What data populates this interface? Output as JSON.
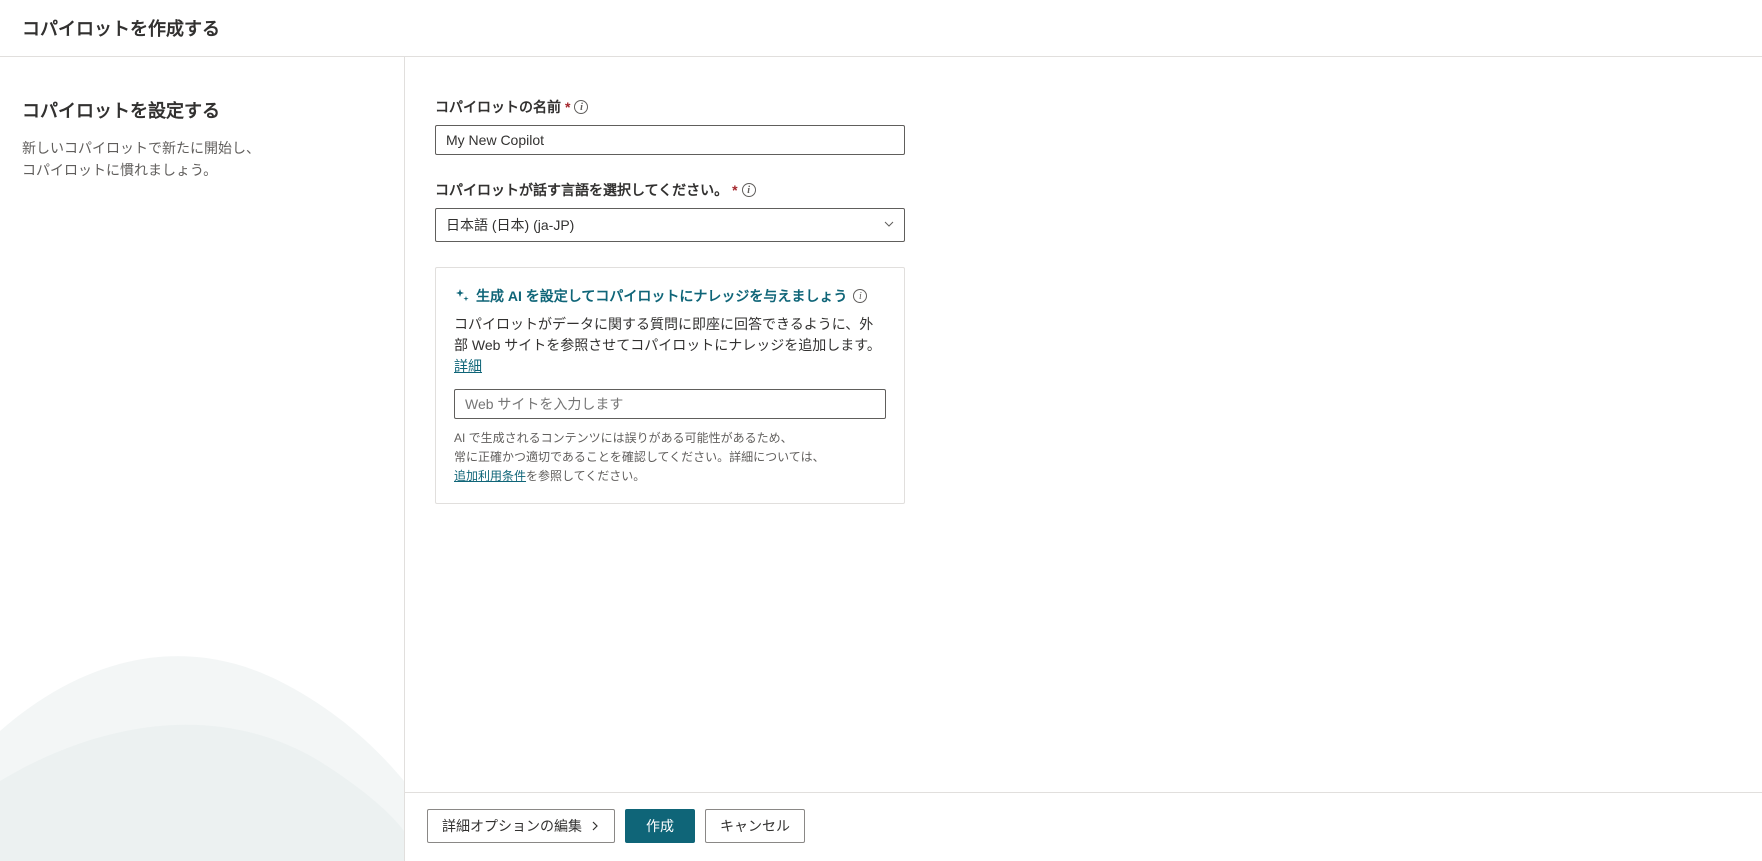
{
  "header": {
    "title": "コパイロットを作成する"
  },
  "sidebar": {
    "title": "コパイロットを設定する",
    "description_line1": "新しいコパイロットで新たに開始し、",
    "description_line2": "コパイロットに慣れましょう。"
  },
  "form": {
    "name": {
      "label": "コパイロットの名前",
      "value": "My New Copilot"
    },
    "language": {
      "label": "コパイロットが話す言語を選択してください。",
      "value": "日本語 (日本) (ja-JP)"
    },
    "ai": {
      "title": "生成 AI を設定してコパイロットにナレッジを与えましょう",
      "description_part1": "コパイロットがデータに関する質問に即座に回答できるように、外部 Web サイトを参照させてコパイロットにナレッジを追加します。",
      "details_link": "詳細",
      "website_placeholder": "Web サイトを入力します",
      "disclaimer_part1": "AI で生成されるコンテンツには誤りがある可能性があるため、",
      "disclaimer_part2": "常に正確かつ適切であることを確認してください。詳細については、",
      "terms_link": "追加利用条件",
      "disclaimer_part3": "を参照してください。"
    }
  },
  "footer": {
    "edit_advanced": "詳細オプションの編集",
    "create": "作成",
    "cancel": "キャンセル"
  }
}
